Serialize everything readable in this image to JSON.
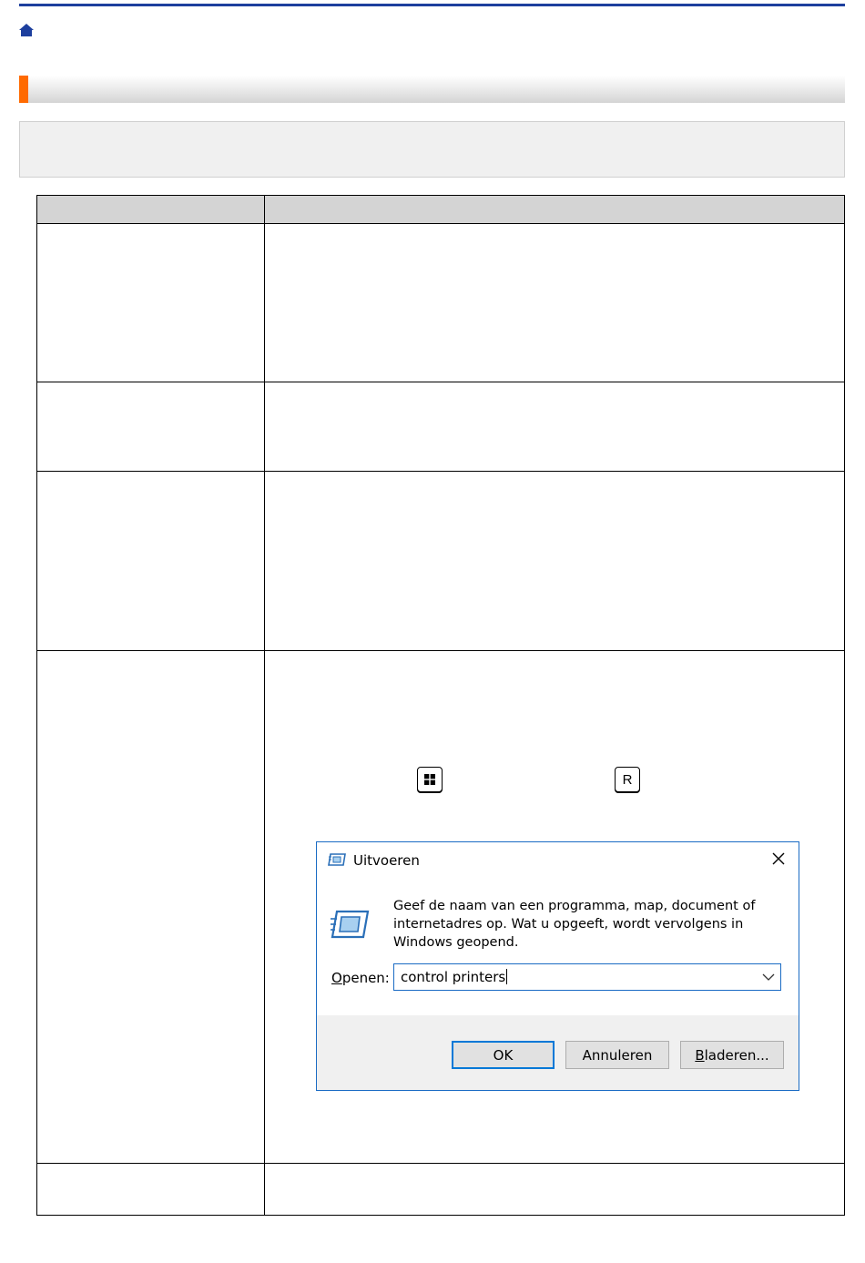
{
  "run_dialog": {
    "title": "Uitvoeren",
    "message": "Geef de naam van een programma, map, document of internetadres op. Wat u opgeeft, wordt vervolgens in Windows geopend.",
    "open_label_accel": "O",
    "open_label_rest": "penen:",
    "input_value": "control printers",
    "ok_label": "OK",
    "cancel_label": "Annuleren",
    "browse_label_accel": "B",
    "browse_label_rest": "laderen..."
  },
  "keys": {
    "r_key": "R"
  },
  "icons": {
    "home": "home-icon",
    "windows_key": "windows-logo-icon",
    "run_app": "run-app-icon",
    "close": "close-icon",
    "dropdown": "chevron-down-icon"
  },
  "colors": {
    "top_rule": "#1d3f9e",
    "title_accent": "#ff6a00",
    "header_fill": "#d4d4d4",
    "note_fill": "#f0f0f0",
    "dialog_accent": "#1a6bc4",
    "ok_border": "#0078d7"
  }
}
